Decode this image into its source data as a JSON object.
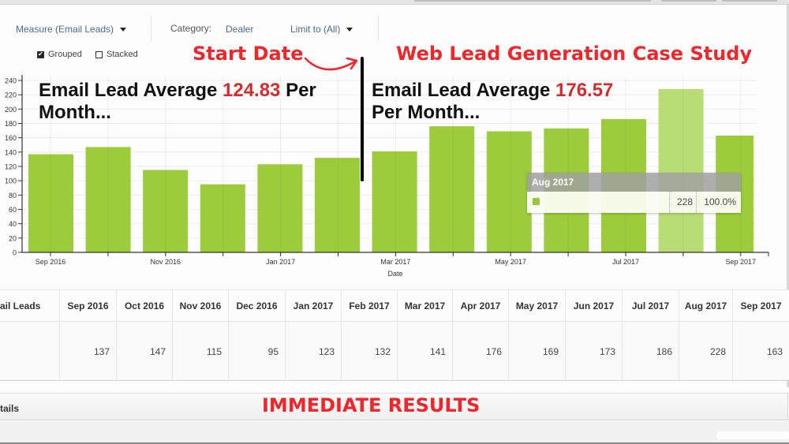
{
  "toolbar": {
    "measure_label": "Measure (Email Leads)",
    "category_label": "Category:",
    "category_value": "Dealer",
    "limit_label": "Limit to (All)"
  },
  "options": {
    "grouped_label": "Grouped",
    "grouped_checked": true,
    "stacked_label": "Stacked",
    "stacked_checked": false
  },
  "annotations": {
    "start_date": "Start Date",
    "case_study_title": "Web Lead Generation Case Study",
    "before_prefix": "Email Lead Average ",
    "before_value": "124.83",
    "before_suffix_line1": " Per",
    "before_line2": "Month...",
    "after_prefix": "Email Lead Average ",
    "after_value": "176.57",
    "after_line2": "Per Month...",
    "immediate_results": "IMMEDIATE RESULTS"
  },
  "colors": {
    "bar": "#9ccc3c",
    "bar_highlight": "#b8dd74",
    "annotation_red": "#f0262b",
    "average_red": "#d12d2f"
  },
  "tooltip": {
    "title": "Aug 2017",
    "value": "228",
    "percent": "100.0%"
  },
  "chart_data": {
    "type": "bar",
    "title": "",
    "xlabel": "Date",
    "ylabel": "",
    "ylim": [
      0,
      240
    ],
    "yticks": [
      0,
      20,
      40,
      60,
      80,
      100,
      120,
      140,
      160,
      180,
      200,
      220,
      240
    ],
    "xtick_labels": [
      "Sep 2016",
      "Nov 2016",
      "Jan 2017",
      "Mar 2017",
      "May 2017",
      "Jul 2017",
      "Sep 2017"
    ],
    "categories": [
      "Sep 2016",
      "Oct 2016",
      "Nov 2016",
      "Dec 2016",
      "Jan 2017",
      "Feb 2017",
      "Mar 2017",
      "Apr 2017",
      "May 2017",
      "Jun 2017",
      "Jul 2017",
      "Aug 2017",
      "Sep 2017"
    ],
    "series": [
      {
        "name": "Email Leads",
        "values": [
          137,
          147,
          115,
          95,
          123,
          132,
          141,
          176,
          169,
          173,
          186,
          228,
          163
        ]
      }
    ],
    "highlighted_category": "Aug 2017",
    "grid": true,
    "legend": "none"
  },
  "table": {
    "row_header": "ail Leads",
    "columns": [
      "Sep 2016",
      "Oct 2016",
      "Nov 2016",
      "Dec 2016",
      "Jan 2017",
      "Feb 2017",
      "Mar 2017",
      "Apr 2017",
      "May 2017",
      "Jun 2017",
      "Jul 2017",
      "Aug 2017",
      "Sep 2017"
    ],
    "values": [
      "137",
      "147",
      "115",
      "95",
      "123",
      "132",
      "141",
      "176",
      "169",
      "173",
      "186",
      "228",
      "163"
    ]
  },
  "details": {
    "label": "tails"
  }
}
